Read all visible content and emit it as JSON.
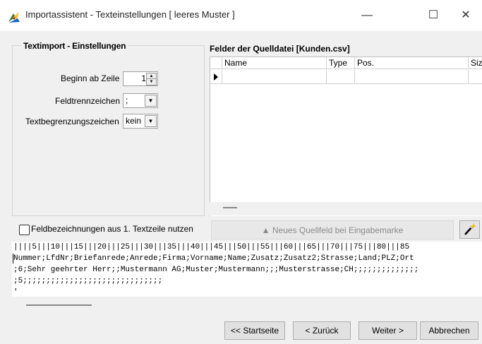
{
  "window": {
    "title": "Importassistent - Texteinstellungen [ leeres Muster ]",
    "minimize_glyph": "—",
    "maximize_glyph": "☐",
    "close_glyph": "✕"
  },
  "settings": {
    "group_title": "Textimport - Einstellungen",
    "start_row_label": "Beginn ab Zeile",
    "start_row_value": "1",
    "delimiter_label": "Feldtrennzeichen",
    "delimiter_value": ";",
    "text_qualifier_label": "Textbegrenzungszeichen",
    "text_qualifier_value": "kein"
  },
  "fields": {
    "title": "Felder der Quelldatei [Kunden.csv]",
    "columns": [
      "Name",
      "Type",
      "Pos.",
      "Size"
    ]
  },
  "header_checkbox_label": "Feldbezeichnungen aus 1. Textzeile nutzen",
  "new_field_button": "▲  Neues Quellfeld bei Eingabemarke",
  "preview": {
    "ruler": "||||5|||10|||15|||20|||25|||30|||35|||40|||45|||50|||55|||60|||65|||70|||75|||80|||85",
    "lines": [
      "Nummer;LfdNr;Briefanrede;Anrede;Firma;Vorname;Name;Zusatz;Zusatz2;Strasse;Land;PLZ;Ort",
      ";6;Sehr geehrter Herr;;Mustermann AG;Muster;Mustermann;;;Musterstrasse;CH;;;;;;;;;;;;;;",
      ";5;;;;;;;;;;;;;;;;;;;;;;;;;;;;;;",
      "'"
    ]
  },
  "buttons": {
    "start": "<< Startseite",
    "back": "< Zurück",
    "next": "Weiter >",
    "cancel": "Abbrechen"
  }
}
